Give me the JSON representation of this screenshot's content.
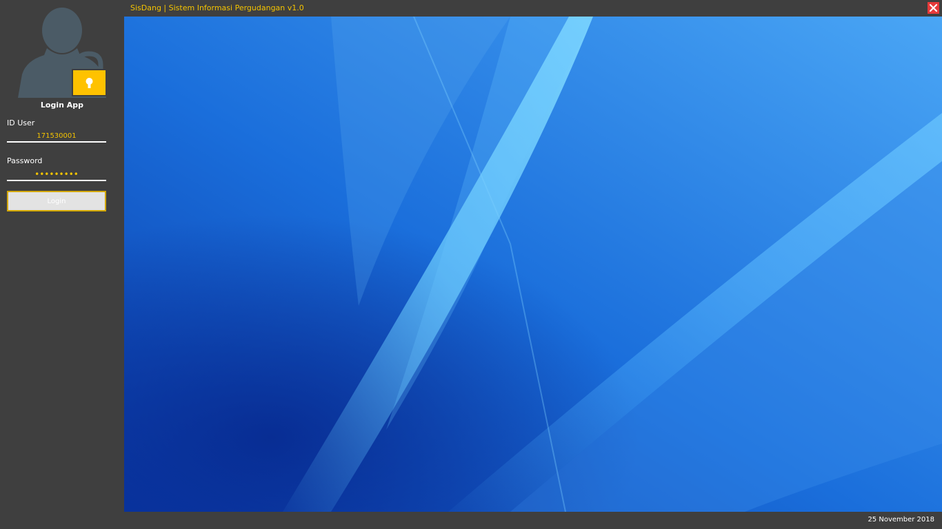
{
  "window": {
    "title": "SisDang | Sistem Informasi Pergudangan v1.0",
    "close_icon": "close-icon"
  },
  "login": {
    "title": "Login App",
    "avatar_icon": "user-lock-icon",
    "id_label": "ID User",
    "id_value": "171530001",
    "password_label": "Password",
    "password_value": "•••••••••",
    "button_label": "Login"
  },
  "status": {
    "date": "25 November 2018"
  },
  "colors": {
    "accent": "#f5c400",
    "panel": "#3f3f3f",
    "close": "#e63a3a",
    "desktop": "#1e6fd9"
  }
}
